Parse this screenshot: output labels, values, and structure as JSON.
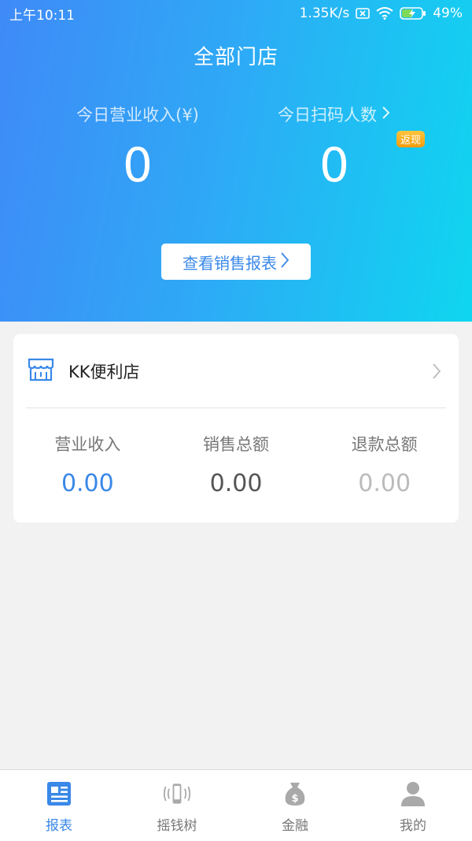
{
  "status_bar": {
    "time": "上午10:11",
    "speed": "1.35K/s",
    "battery": "49%"
  },
  "header": {
    "title": "全部门店",
    "revenue_label": "今日营业收入(¥)",
    "revenue_value": "0",
    "scan_label": "今日扫码人数",
    "scan_value": "0",
    "cashback_badge": "返现",
    "report_button": "查看销售报表"
  },
  "store": {
    "name": "KK便利店",
    "metrics": [
      {
        "label": "营业收入",
        "value": "0.00",
        "color": "#3a88e8"
      },
      {
        "label": "销售总额",
        "value": "0.00",
        "color": "#555555"
      },
      {
        "label": "退款总额",
        "value": "0.00",
        "color": "#bbbbbb"
      }
    ]
  },
  "nav": {
    "items": [
      {
        "label": "报表",
        "icon": "report-icon",
        "active": true
      },
      {
        "label": "摇钱树",
        "icon": "shake-phone-icon",
        "active": false
      },
      {
        "label": "金融",
        "icon": "money-bag-icon",
        "active": false
      },
      {
        "label": "我的",
        "icon": "user-icon",
        "active": false
      }
    ]
  },
  "colors": {
    "accent": "#3a88e8",
    "gradient_start": "#3f8af7",
    "gradient_end": "#0fd6f0",
    "badge": "#f5a623"
  }
}
